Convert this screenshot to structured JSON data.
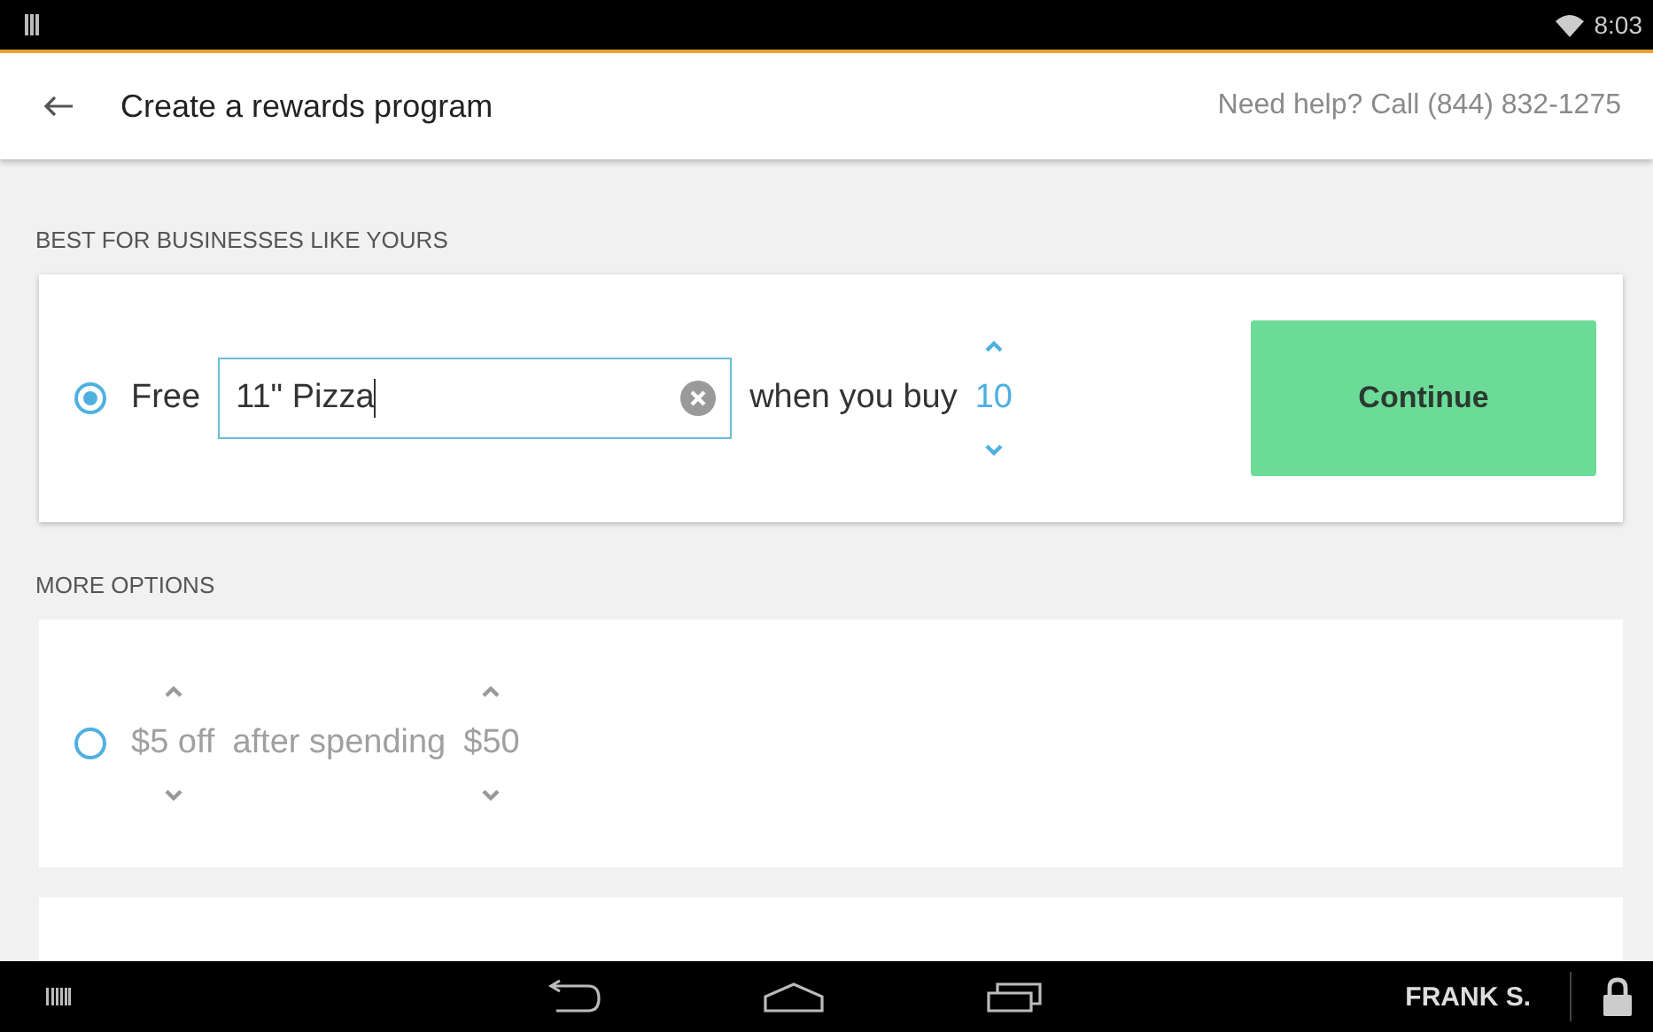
{
  "status_bar": {
    "time": "8:03"
  },
  "app_bar": {
    "title": "Create a rewards program",
    "help": "Need help? Call (844) 832-1275"
  },
  "best": {
    "heading": "BEST FOR BUSINESSES LIKE YOURS",
    "option": {
      "selected": true,
      "prefix": "Free",
      "item": "11\" Pizza",
      "connector": "when you buy",
      "count": "10"
    },
    "button": "Continue"
  },
  "more": {
    "heading": "MORE OPTIONS",
    "options": [
      {
        "selected": false,
        "amount": "$5 off",
        "connector": "after spending",
        "threshold": "$50"
      }
    ]
  },
  "nav_bar": {
    "user": "FRANK S."
  }
}
